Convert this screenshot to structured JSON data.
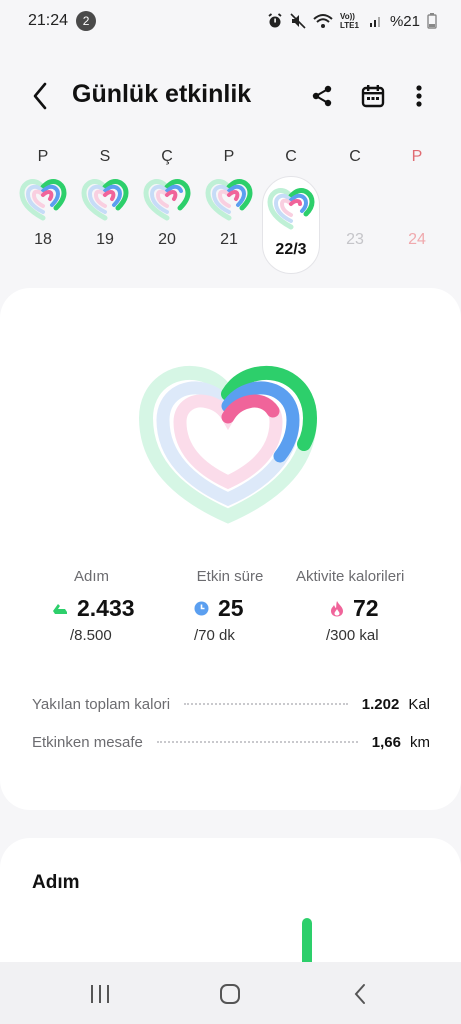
{
  "status_bar": {
    "time": "21:24",
    "notification_count": "2",
    "network_label": "Vo)) LTE1",
    "battery_percent": "%21"
  },
  "header": {
    "title": "Günlük etkinlik"
  },
  "days": [
    {
      "label": "P",
      "date": "18"
    },
    {
      "label": "S",
      "date": "19"
    },
    {
      "label": "Ç",
      "date": "20"
    },
    {
      "label": "P",
      "date": "21"
    },
    {
      "label": "C",
      "date": "22/3"
    },
    {
      "label": "C",
      "date": "23"
    },
    {
      "label": "P",
      "date": "24"
    }
  ],
  "stats": {
    "steps": {
      "label": "Adım",
      "value": "2.433",
      "goal": "/8.500"
    },
    "active_time": {
      "label": "Etkin süre",
      "value": "25",
      "goal": "/70 dk"
    },
    "active_calories": {
      "label": "Aktivite kalorileri",
      "value": "72",
      "goal": "/300 kal"
    }
  },
  "summary": {
    "total_calories": {
      "label": "Yakılan toplam kalori",
      "value": "1.202",
      "unit": "Kal"
    },
    "active_distance": {
      "label": "Etkinken mesafe",
      "value": "1,66",
      "unit": "km"
    }
  },
  "steps_card": {
    "title": "Adım"
  },
  "colors": {
    "steps_green": "#2dcf6b",
    "time_blue": "#5b9ff0",
    "calorie_pink": "#f0649a",
    "weekend_red": "#e06b72"
  }
}
